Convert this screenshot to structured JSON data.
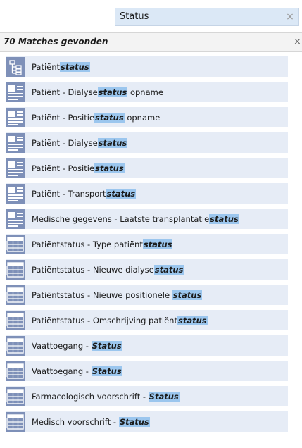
{
  "search": {
    "value": "Status",
    "clear_label": "×"
  },
  "results": {
    "count_label": "70 Matches gevonden",
    "close_label": "×"
  },
  "items": [
    {
      "icon": "tree-icon",
      "prefix": "Patiënt",
      "match": "status",
      "suffix": ""
    },
    {
      "icon": "form-icon",
      "prefix": "Patiënt - Dialyse",
      "match": "status",
      "suffix": " opname"
    },
    {
      "icon": "form-icon",
      "prefix": "Patiënt - Positie",
      "match": "status",
      "suffix": " opname"
    },
    {
      "icon": "form-icon",
      "prefix": "Patiënt - Dialyse",
      "match": "status",
      "suffix": ""
    },
    {
      "icon": "form-icon",
      "prefix": "Patiënt - Positie",
      "match": "status",
      "suffix": ""
    },
    {
      "icon": "form-icon",
      "prefix": "Patiënt - Transport",
      "match": "status",
      "suffix": ""
    },
    {
      "icon": "form-icon",
      "prefix": "Medische gegevens - Laatste transplantatie",
      "match": "status",
      "suffix": ""
    },
    {
      "icon": "table-icon",
      "prefix": "Patiëntstatus - Type patiënt",
      "match": "status",
      "suffix": ""
    },
    {
      "icon": "table-icon",
      "prefix": "Patiëntstatus - Nieuwe dialyse",
      "match": "status",
      "suffix": ""
    },
    {
      "icon": "table-icon",
      "prefix": "Patiëntstatus - Nieuwe positionele ",
      "match": "status",
      "suffix": ""
    },
    {
      "icon": "table-icon",
      "prefix": "Patiëntstatus - Omschrijving patiënt",
      "match": "status",
      "suffix": ""
    },
    {
      "icon": "table-icon",
      "prefix": "Vaattoegang - ",
      "match": "Status",
      "suffix": ""
    },
    {
      "icon": "table-icon",
      "prefix": "Vaattoegang - ",
      "match": "Status",
      "suffix": ""
    },
    {
      "icon": "table-icon",
      "prefix": "Farmacologisch voorschrift - ",
      "match": "Status",
      "suffix": ""
    },
    {
      "icon": "table-icon",
      "prefix": "Medisch voorschrift - ",
      "match": "Status",
      "suffix": ""
    }
  ],
  "colors": {
    "search_bg": "#dbe8f6",
    "row_bg": "#e6ecf6",
    "icon_bg": "#7e90b8",
    "highlight": "#9bc6ee"
  }
}
